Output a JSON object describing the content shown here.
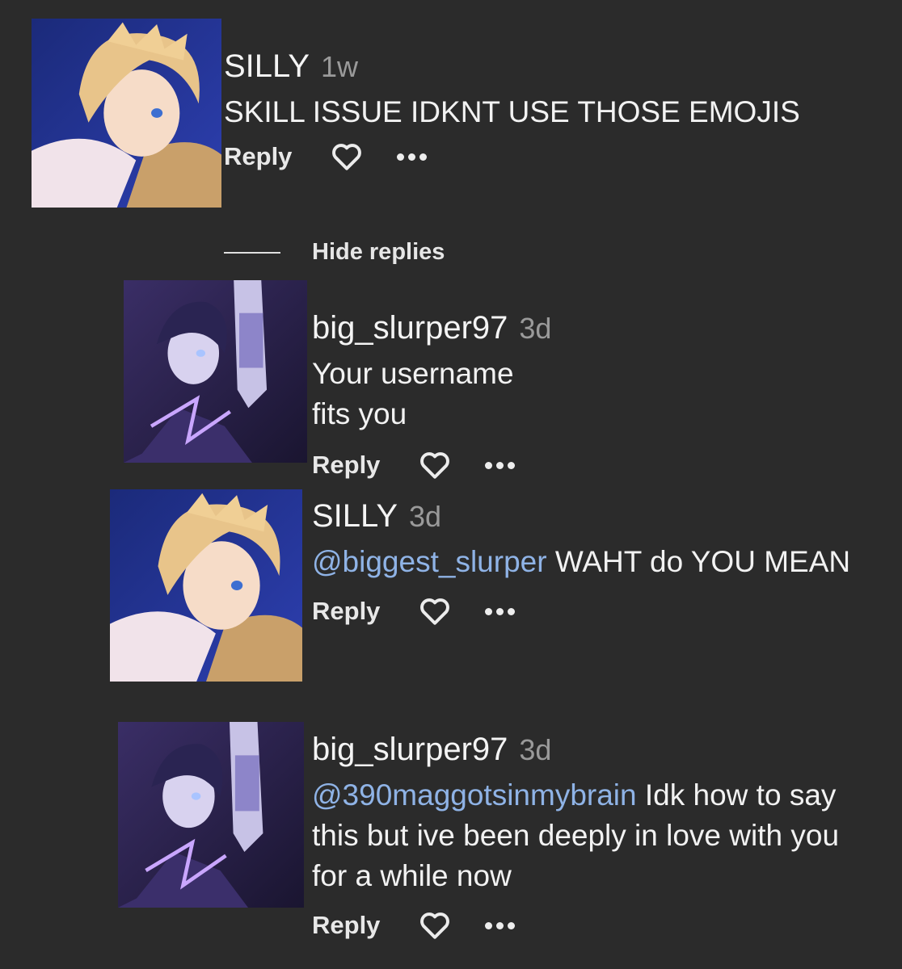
{
  "comments": [
    {
      "username": "SILLY",
      "time": "1w",
      "mention": "",
      "text": "SKILL ISSUE IDKNT USE THOSE EMOJIS",
      "reply_label": "Reply",
      "avatar": "blonde-character-avatar"
    },
    {
      "username": "big_slurper97",
      "time": "3d",
      "mention": "",
      "text": "Your username fits you",
      "reply_label": "Reply",
      "avatar": "purple-character-avatar"
    },
    {
      "username": "SILLY",
      "time": "3d",
      "mention": "@biggest_slurper",
      "text": " WAHT do YOU MEAN",
      "reply_label": "Reply",
      "avatar": "blonde-character-avatar"
    },
    {
      "username": "big_slurper97",
      "time": "3d",
      "mention": "@390maggotsinmybrain",
      "text": " Idk how to say this but ive been deeply in love with you for a while now",
      "reply_label": "Reply",
      "avatar": "purple-character-avatar"
    }
  ],
  "hide_replies_label": "Hide replies",
  "colors": {
    "background": "#2b2b2b",
    "mention": "#8fb3e6",
    "timestamp": "#9a9a9a"
  }
}
